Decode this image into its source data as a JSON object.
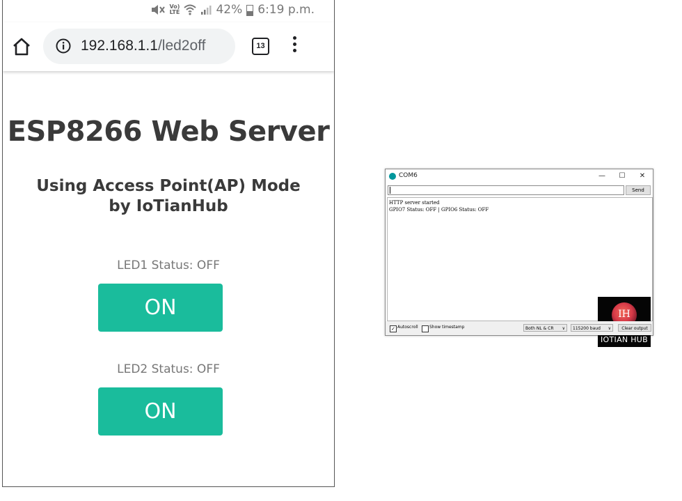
{
  "status_bar": {
    "volte_top": "Vo)",
    "volte_bottom": "LTE",
    "battery": "42%",
    "time": "6:19 p.m."
  },
  "browser": {
    "url_host": "192.168.1.1",
    "url_path": "/led2off",
    "tab_count": "13"
  },
  "page": {
    "title": "ESP8266 Web Server",
    "subtitle": "Using Access Point(AP) Mode by IoTianHub",
    "led1_status": "LED1 Status: OFF",
    "led1_button": "ON",
    "led2_status": "LED2 Status: OFF",
    "led2_button": "ON",
    "button_color": "#1abc9c"
  },
  "serial_monitor": {
    "title": "COM6",
    "send_label": "Send",
    "lines": [
      "HTTP server started",
      "GPIO7 Status: OFF | GPIO6 Status: OFF"
    ],
    "autoscroll_label": "Autoscroll",
    "autoscroll_checked": true,
    "timestamp_label": "Show timestamp",
    "timestamp_checked": false,
    "line_ending": "Both NL & CR",
    "baud": "115200 baud",
    "clear_label": "Clear output",
    "logo_monogram": "IH",
    "logo_text": "IOTIAN HUB"
  }
}
